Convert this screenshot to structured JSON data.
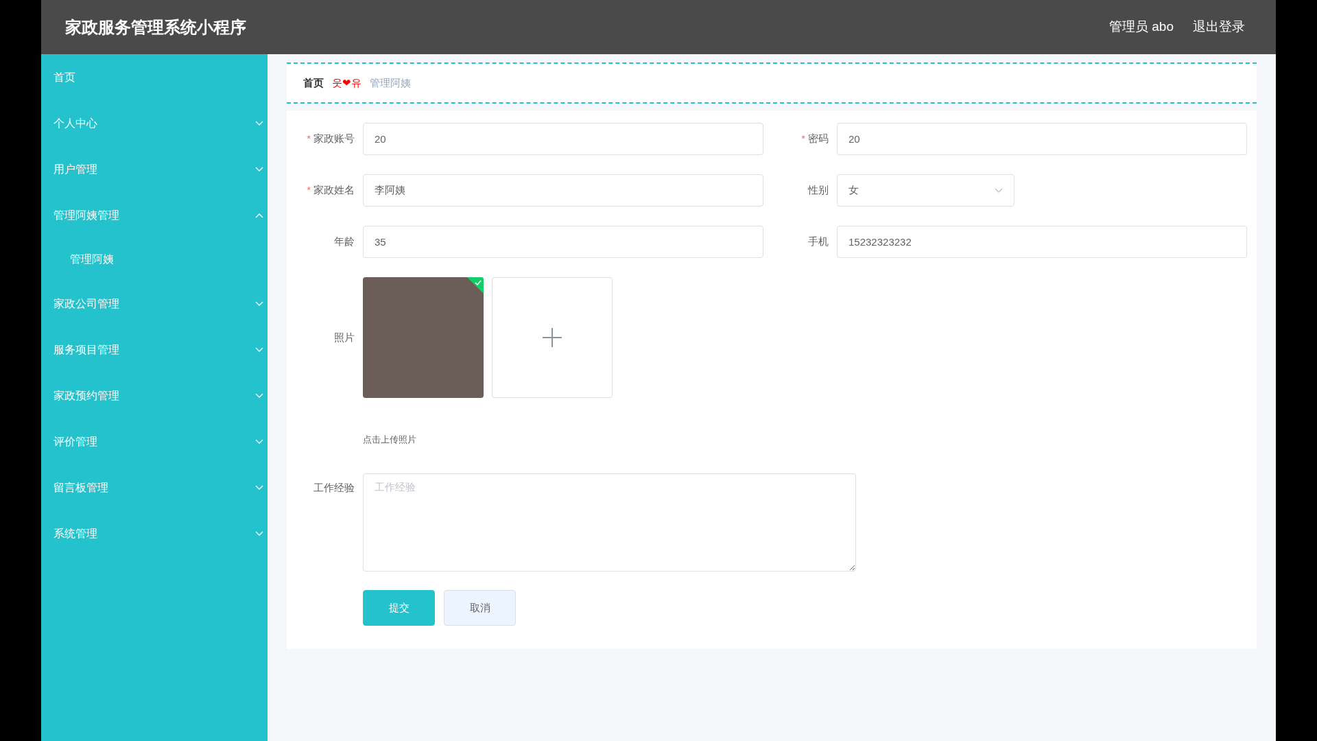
{
  "header": {
    "title": "家政服务管理系统小程序",
    "user": "管理员 abo",
    "logout": "退出登录"
  },
  "sidebar": {
    "items": [
      {
        "kind": "link",
        "label": "首页"
      },
      {
        "kind": "group",
        "label": "个人中心",
        "expanded": false
      },
      {
        "kind": "group",
        "label": "用户管理",
        "expanded": false
      },
      {
        "kind": "group",
        "label": "管理阿姨管理",
        "expanded": true,
        "children": [
          {
            "label": "管理阿姨"
          }
        ]
      },
      {
        "kind": "group",
        "label": "家政公司管理",
        "expanded": false
      },
      {
        "kind": "group",
        "label": "服务项目管理",
        "expanded": false
      },
      {
        "kind": "group",
        "label": "家政预约管理",
        "expanded": false
      },
      {
        "kind": "group",
        "label": "评价管理",
        "expanded": false
      },
      {
        "kind": "group",
        "label": "留言板管理",
        "expanded": false
      },
      {
        "kind": "group",
        "label": "系统管理",
        "expanded": false
      }
    ]
  },
  "breadcrumb": {
    "home": "首页",
    "separator": "웃❤유",
    "current": "管理阿姨"
  },
  "form": {
    "rows": [
      [
        {
          "kind": "text",
          "label": "家政账号",
          "required_mark": "*",
          "value": "20"
        },
        {
          "kind": "text",
          "label": "密码",
          "required_mark": "*",
          "value": "20"
        }
      ],
      [
        {
          "kind": "text",
          "label": "家政姓名",
          "required_mark": "*",
          "value": "李阿姨"
        },
        {
          "kind": "select",
          "label": "性别",
          "value": "女"
        }
      ],
      [
        {
          "kind": "text",
          "label": "年龄",
          "value": "35"
        },
        {
          "kind": "text",
          "label": "手机",
          "value": "15232323232"
        }
      ]
    ],
    "photo": {
      "label": "照片",
      "uploaded": true,
      "hint": "点击上传照片"
    },
    "experience": {
      "label": "工作经验",
      "placeholder": "工作经验"
    },
    "buttons": [
      {
        "kind": "primary",
        "label": "提交"
      },
      {
        "kind": "default",
        "label": "取消"
      }
    ]
  }
}
